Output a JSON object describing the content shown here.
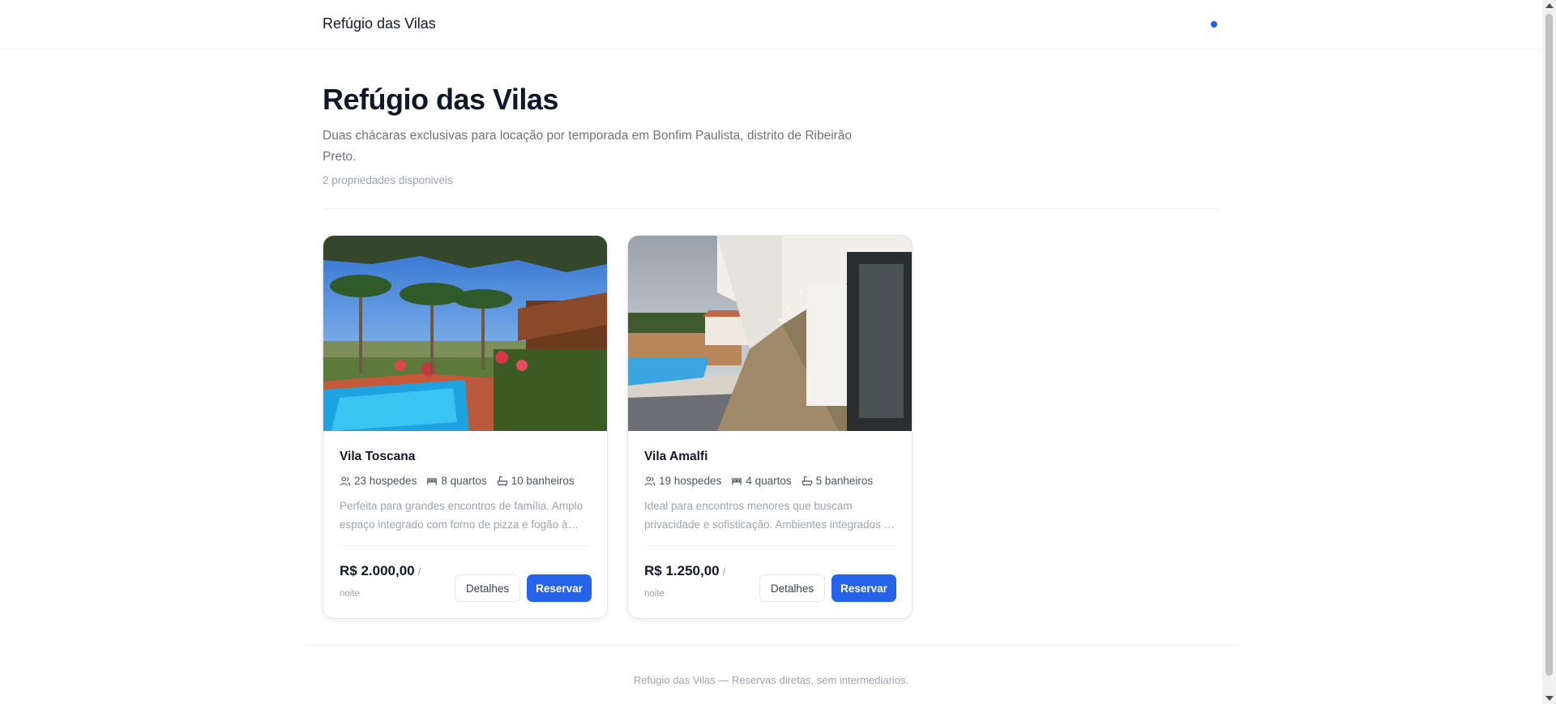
{
  "header": {
    "brand": "Refúgio das Vilas",
    "status_dot_color": "#2563eb"
  },
  "hero": {
    "title": "Refúgio das Vilas",
    "subtitle": "Duas chácaras exclusivas para locação por temporada em Bonfim Paulista, distrito de Ribeirão Preto.",
    "count": "2 propriedades disponiveis"
  },
  "properties": [
    {
      "name": "Vila Toscana",
      "guests": "23 hospedes",
      "rooms": "8 quartos",
      "bathrooms": "10 banheiros",
      "description": "Perfeita para grandes encontros de família. Amplo espaço integrado com forno de pizza e fogão à lenha.",
      "price": "R$ 2.000,00",
      "price_slash": "/",
      "price_unit": "noite",
      "details_label": "Detalhes",
      "reserve_label": "Reservar"
    },
    {
      "name": "Vila Amalfi",
      "guests": "19 hospedes",
      "rooms": "4 quartos",
      "bathrooms": "5 banheiros",
      "description": "Ideal para encontros menores que buscam privacidade e sofisticação. Ambientes integrados e modernos.",
      "price": "R$ 1.250,00",
      "price_slash": "/",
      "price_unit": "noite",
      "details_label": "Detalhes",
      "reserve_label": "Reservar"
    }
  ],
  "footer": {
    "text": "Refúgio das Vilas — Reservas diretas, sem intermediarios."
  },
  "colors": {
    "accent": "#2563eb",
    "heading": "#0f172a",
    "muted": "#9ca3af"
  }
}
